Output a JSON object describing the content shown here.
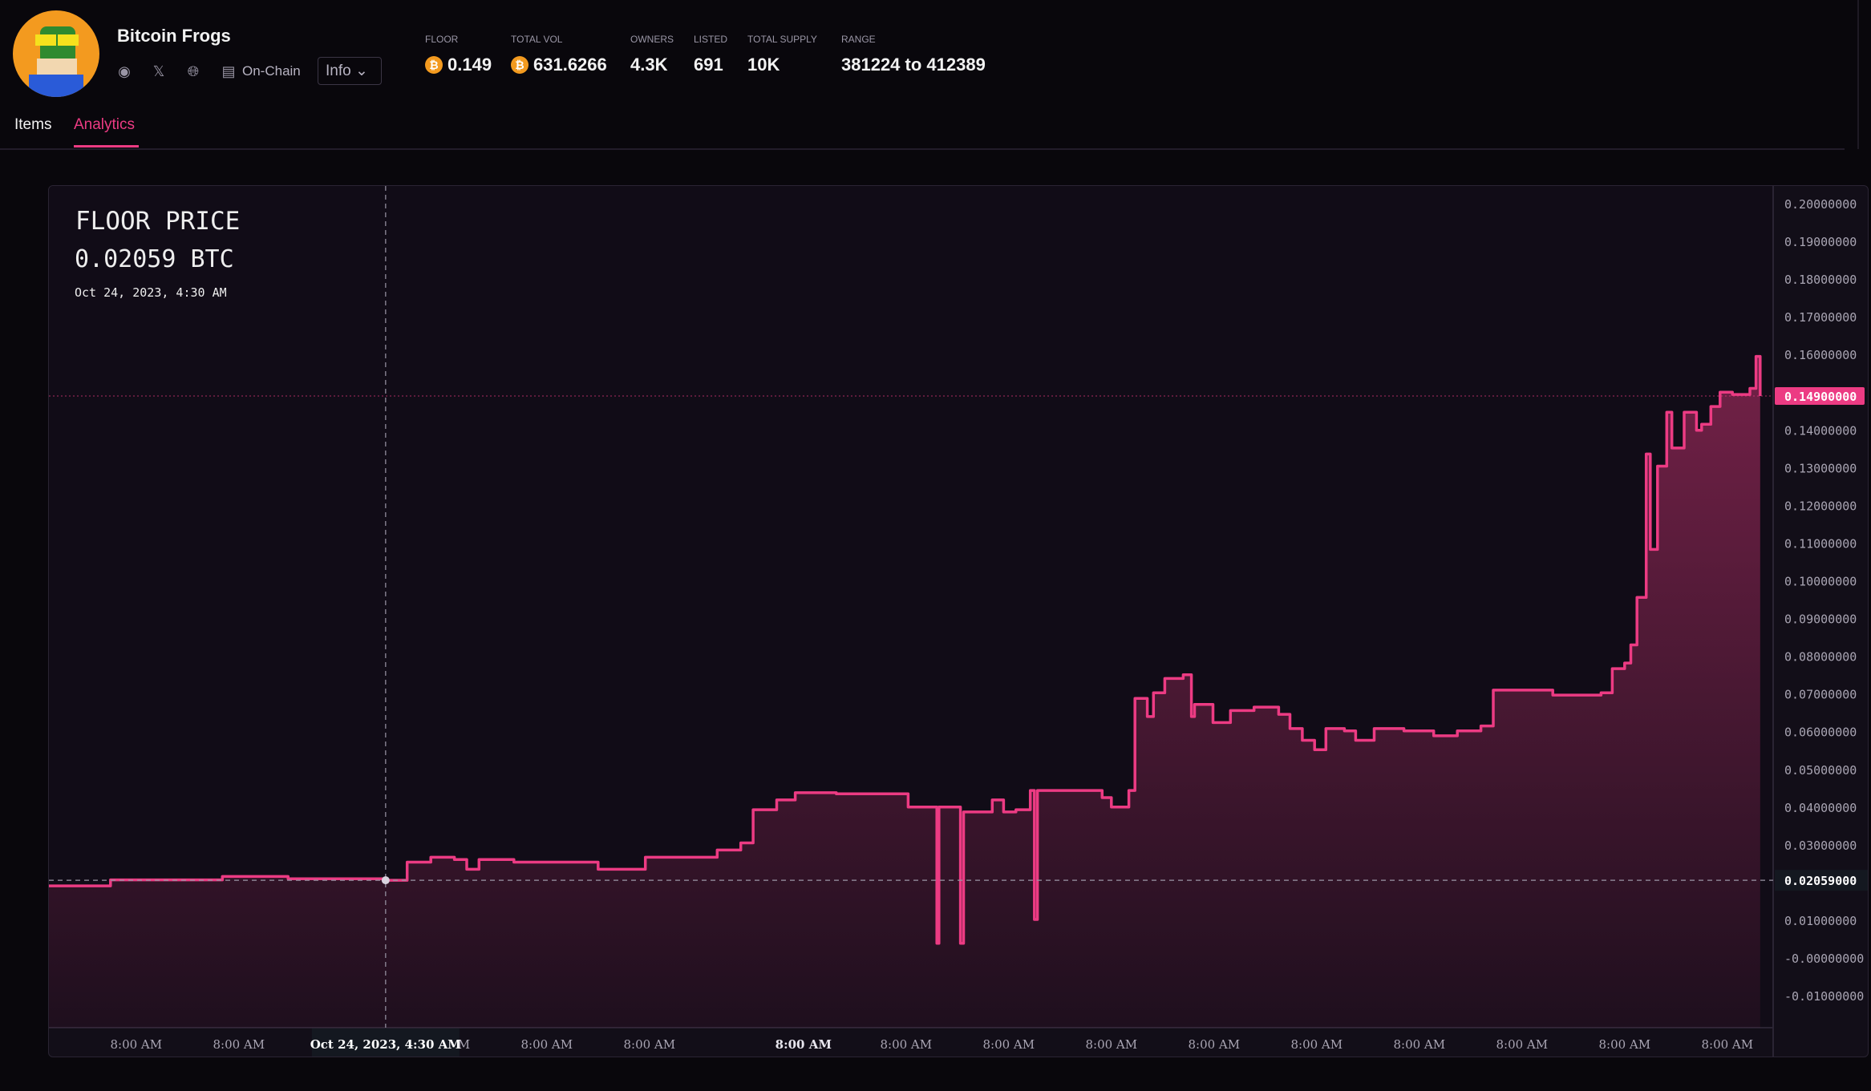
{
  "collection": {
    "name": "Bitcoin Frogs",
    "onchain_label": "On-Chain",
    "info_label": "Info"
  },
  "stats": [
    {
      "label": "FLOOR",
      "value": "0.149",
      "btc": true
    },
    {
      "label": "TOTAL VOL",
      "value": "631.6266",
      "btc": true
    },
    {
      "label": "OWNERS",
      "value": "4.3K"
    },
    {
      "label": "LISTED",
      "value": "691"
    },
    {
      "label": "TOTAL SUPPLY",
      "value": "10K"
    },
    {
      "label": "RANGE",
      "value": "381224 to 412389"
    }
  ],
  "tabs": [
    {
      "label": "Items",
      "active": false
    },
    {
      "label": "Analytics",
      "active": true
    }
  ],
  "tooltip": {
    "title": "FLOOR PRICE",
    "value": "0.02059 BTC",
    "date": "Oct 24, 2023, 4:30 AM"
  },
  "colors": {
    "accent": "#ec3b83",
    "background": "#09070c",
    "panel": "#120e18"
  },
  "chart_data": {
    "type": "area",
    "title": "FLOOR PRICE",
    "ylabel": "BTC",
    "xlabel": "",
    "ylim": [
      -0.015,
      0.205
    ],
    "xlim_days": [
      0,
      16.8
    ],
    "y_ticks": [
      "0.20000000",
      "0.19000000",
      "0.18000000",
      "0.17000000",
      "0.16000000",
      "0.14000000",
      "0.13000000",
      "0.12000000",
      "0.11000000",
      "0.10000000",
      "0.09000000",
      "0.08000000",
      "0.07000000",
      "0.06000000",
      "0.05000000",
      "0.04000000",
      "0.03000000",
      "0.01000000",
      "-0.00000000",
      "-0.01000000"
    ],
    "y_tick_values": [
      0.2,
      0.19,
      0.18,
      0.17,
      0.16,
      0.14,
      0.13,
      0.12,
      0.11,
      0.1,
      0.09,
      0.08,
      0.07,
      0.06,
      0.05,
      0.04,
      0.03,
      0.01,
      0.0,
      -0.01
    ],
    "x_ticks": [
      {
        "day": 0.85,
        "label": "8:00 AM"
      },
      {
        "day": 1.85,
        "label": "8:00 AM"
      },
      {
        "day": 2.85,
        "label": "8:00 AM"
      },
      {
        "day": 3.85,
        "label": "8:00 AM"
      },
      {
        "day": 4.85,
        "label": "8:00 AM"
      },
      {
        "day": 5.85,
        "label": "8:00 AM"
      },
      {
        "day": 7.35,
        "label": "8:00 AM",
        "bold": true
      },
      {
        "day": 8.35,
        "label": "8:00 AM"
      },
      {
        "day": 9.35,
        "label": "8:00 AM"
      },
      {
        "day": 10.35,
        "label": "8:00 AM"
      },
      {
        "day": 11.35,
        "label": "8:00 AM"
      },
      {
        "day": 12.35,
        "label": "8:00 AM"
      },
      {
        "day": 13.35,
        "label": "8:00 AM"
      },
      {
        "day": 14.35,
        "label": "8:00 AM"
      },
      {
        "day": 15.35,
        "label": "8:00 AM"
      },
      {
        "day": 16.35,
        "label": "8:00 AM"
      }
    ],
    "last_price": {
      "value": 0.149,
      "label": "0.14900000"
    },
    "crosshair": {
      "day": 3.28,
      "value": 0.02059,
      "y_label": "0.02059000",
      "x_label": "Oct 24, 2023, 4:30 AM"
    },
    "series": [
      {
        "name": "Floor price",
        "points": [
          [
            0,
            0.0191
          ],
          [
            0.58,
            0.0191
          ],
          [
            0.6,
            0.0207
          ],
          [
            1.69,
            0.0216
          ],
          [
            1.98,
            0.0216
          ],
          [
            2.33,
            0.021
          ],
          [
            3.28,
            0.02059
          ],
          [
            3.49,
            0.0254
          ],
          [
            3.72,
            0.0267
          ],
          [
            3.95,
            0.0261
          ],
          [
            4.07,
            0.0235
          ],
          [
            4.19,
            0.0261
          ],
          [
            4.53,
            0.0254
          ],
          [
            5.23,
            0.0254
          ],
          [
            5.35,
            0.0235
          ],
          [
            5.81,
            0.0267
          ],
          [
            6.51,
            0.0286
          ],
          [
            6.74,
            0.0305
          ],
          [
            6.86,
            0.0393
          ],
          [
            7.09,
            0.0419
          ],
          [
            7.27,
            0.0438
          ],
          [
            7.67,
            0.0435
          ],
          [
            8.14,
            0.0435
          ],
          [
            8.37,
            0.04
          ],
          [
            8.64,
            0.04
          ],
          [
            8.65,
            0.0039
          ],
          [
            8.67,
            0.04
          ],
          [
            8.84,
            0.04
          ],
          [
            8.88,
            0.0039
          ],
          [
            8.91,
            0.0387
          ],
          [
            9.19,
            0.0419
          ],
          [
            9.3,
            0.0387
          ],
          [
            9.42,
            0.0393
          ],
          [
            9.56,
            0.0444
          ],
          [
            9.6,
            0.0102
          ],
          [
            9.63,
            0.0444
          ],
          [
            10.0,
            0.0444
          ],
          [
            10.26,
            0.0425
          ],
          [
            10.35,
            0.04
          ],
          [
            10.52,
            0.0444
          ],
          [
            10.58,
            0.0688
          ],
          [
            10.7,
            0.064
          ],
          [
            10.76,
            0.0703
          ],
          [
            10.87,
            0.0741
          ],
          [
            11.05,
            0.0751
          ],
          [
            11.13,
            0.064
          ],
          [
            11.16,
            0.0672
          ],
          [
            11.34,
            0.0624
          ],
          [
            11.51,
            0.0656
          ],
          [
            11.74,
            0.0665
          ],
          [
            11.98,
            0.0646
          ],
          [
            12.09,
            0.0608
          ],
          [
            12.21,
            0.0577
          ],
          [
            12.33,
            0.0552
          ],
          [
            12.44,
            0.0608
          ],
          [
            12.62,
            0.0602
          ],
          [
            12.73,
            0.0577
          ],
          [
            12.91,
            0.0608
          ],
          [
            13.2,
            0.0602
          ],
          [
            13.49,
            0.0589
          ],
          [
            13.72,
            0.0602
          ],
          [
            13.95,
            0.0615
          ],
          [
            14.07,
            0.071
          ],
          [
            14.42,
            0.071
          ],
          [
            14.65,
            0.0697
          ],
          [
            15.12,
            0.0703
          ],
          [
            15.23,
            0.0767
          ],
          [
            15.35,
            0.0782
          ],
          [
            15.41,
            0.083
          ],
          [
            15.47,
            0.0956
          ],
          [
            15.56,
            0.1336
          ],
          [
            15.6,
            0.1083
          ],
          [
            15.67,
            0.1304
          ],
          [
            15.76,
            0.1447
          ],
          [
            15.81,
            0.1352
          ],
          [
            15.93,
            0.1447
          ],
          [
            16.05,
            0.1399
          ],
          [
            16.1,
            0.1415
          ],
          [
            16.19,
            0.1462
          ],
          [
            16.28,
            0.15
          ],
          [
            16.4,
            0.1494
          ],
          [
            16.57,
            0.151
          ],
          [
            16.63,
            0.1595
          ],
          [
            16.67,
            0.149
          ]
        ]
      }
    ]
  }
}
